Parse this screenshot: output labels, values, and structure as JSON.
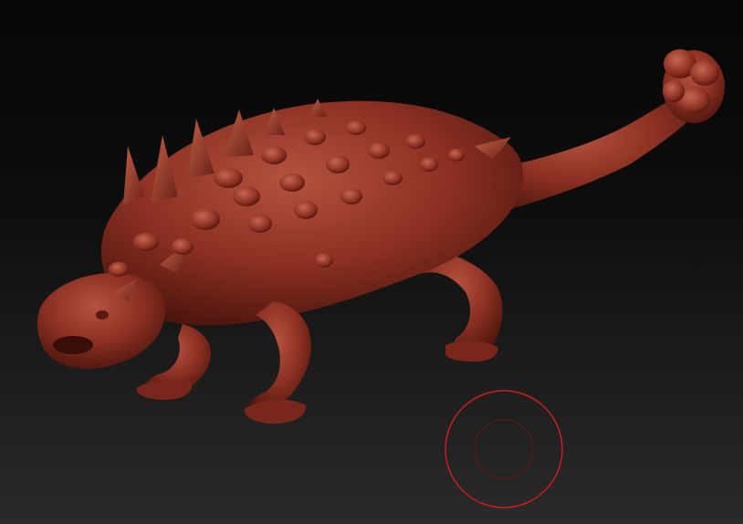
{
  "viewport": {
    "background_top": "#060606",
    "background_bottom": "#2a2a2a"
  },
  "model": {
    "subject": "ankylosaur-sculpt",
    "material_color": "#8a2f22",
    "highlight_color": "#b5523f",
    "shadow_color": "#4a140d"
  },
  "brush": {
    "outer_ring_color": "#c81e1e",
    "inner_ring_color": "#6e1414"
  }
}
